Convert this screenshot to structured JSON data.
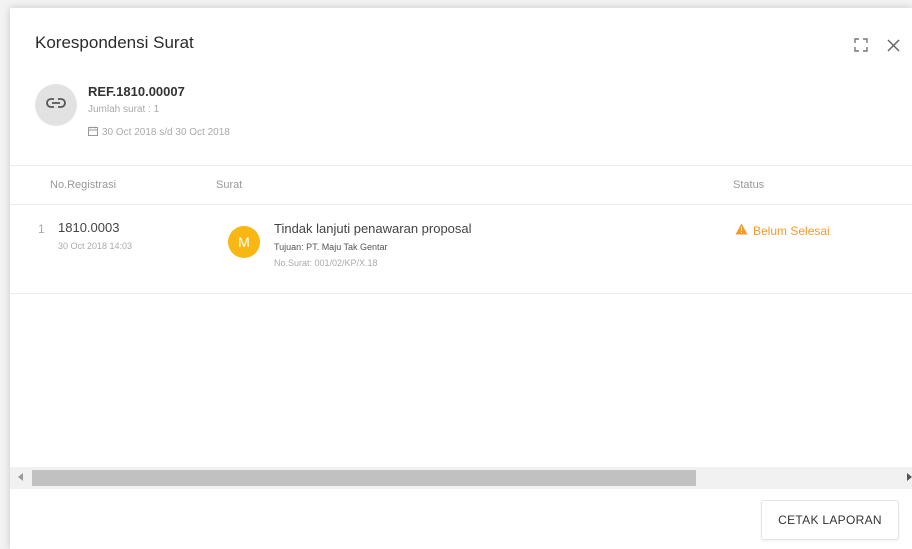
{
  "dialog": {
    "title": "Korespondensi Surat",
    "icons": {
      "expand": "expand-icon",
      "close": "close-icon"
    }
  },
  "reference": {
    "icon": "link-icon",
    "number": "REF.1810.00007",
    "count_text": "Jumlah surat : 1",
    "date_icon": "calendar-icon",
    "date_range": "30 Oct 2018 s/d 30 Oct 2018"
  },
  "table": {
    "headers": {
      "registrasi": "No.Registrasi",
      "surat": "Surat",
      "status": "Status"
    },
    "rows": [
      {
        "num": "1",
        "reg_no": "1810.0003",
        "reg_date": "30 Oct 2018 14:03",
        "avatar_letter": "M",
        "title": "Tindak lanjuti penawaran proposal",
        "tujuan": "Tujuan: PT. Maju Tak Gentar",
        "no_surat": "No.Surat: 001/02/KP/X.18",
        "status_icon": "warning-icon",
        "status": "Belum Selesai"
      }
    ]
  },
  "footer": {
    "cetak_label": "CETAK LAPORAN"
  },
  "colors": {
    "avatar": "#f9b714",
    "status_warning": "#f49a2b",
    "accent_text": "#333333"
  }
}
